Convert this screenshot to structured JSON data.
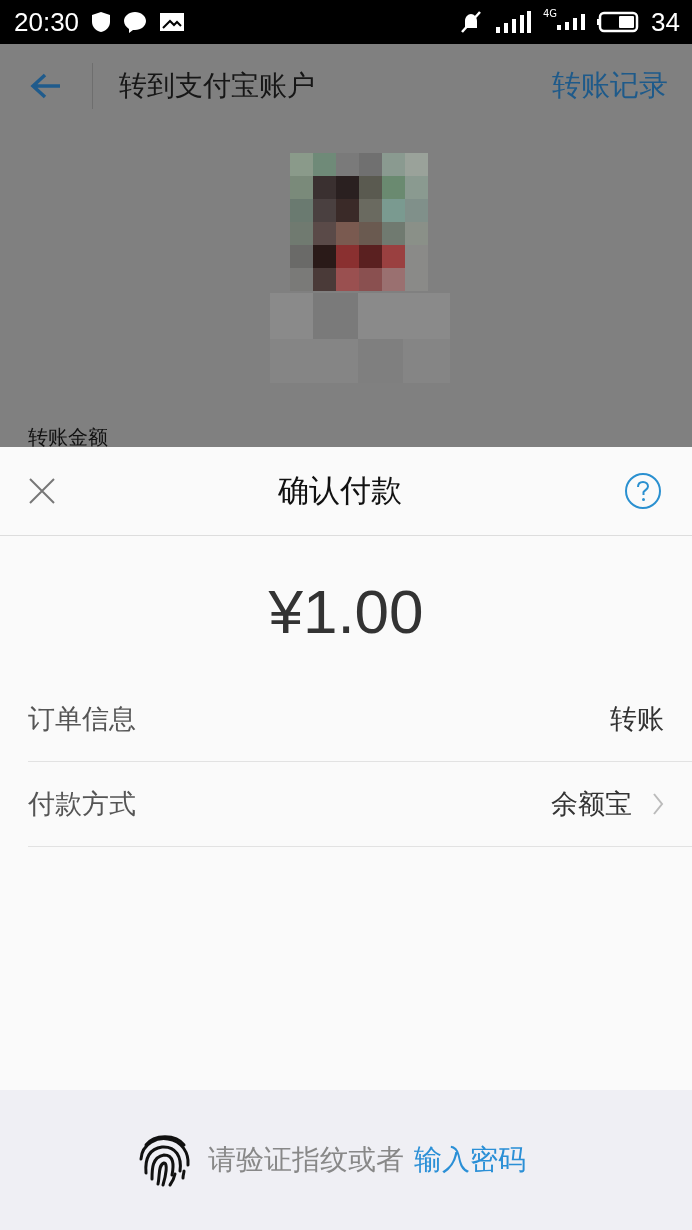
{
  "status_bar": {
    "time": "20:30",
    "network": "4G",
    "battery": "34"
  },
  "header": {
    "title": "转到支付宝账户",
    "link": "转账记录"
  },
  "background": {
    "amount_label": "转账金额"
  },
  "sheet": {
    "title": "确认付款",
    "amount": "¥1.00",
    "rows": [
      {
        "label": "订单信息",
        "value": "转账",
        "kind": "info"
      },
      {
        "label": "付款方式",
        "value": "余额宝",
        "kind": "select"
      }
    ]
  },
  "footer": {
    "prompt": "请验证指纹或者",
    "link": "输入密码"
  }
}
